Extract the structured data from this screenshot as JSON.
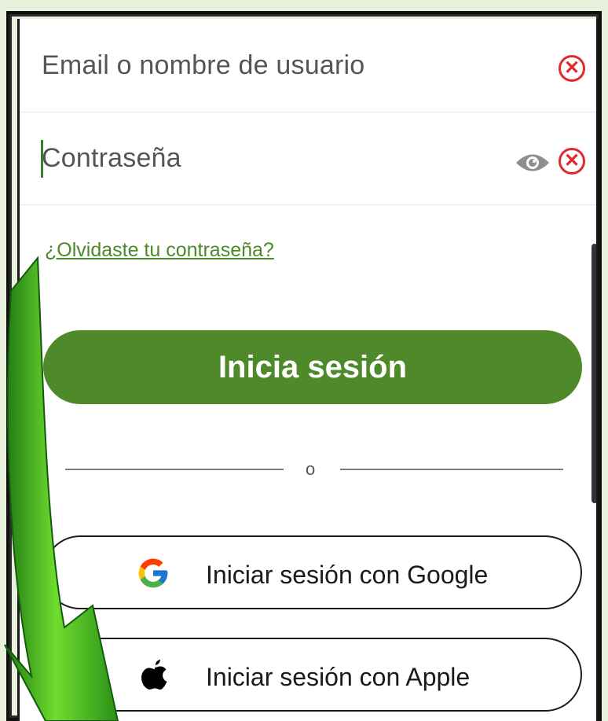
{
  "form": {
    "email_placeholder": "Email o nombre de usuario",
    "password_placeholder": "Contraseña",
    "forgot_link": "¿Olvidaste tu contraseña?",
    "login_button": "Inicia sesión",
    "divider_text": "o",
    "google_button": "Iniciar sesión con Google",
    "apple_button": "Iniciar sesión con Apple"
  },
  "icons": {
    "clear": "x-circle-icon",
    "visibility": "eye-icon",
    "google": "google-logo-icon",
    "apple": "apple-logo-icon",
    "annotation": "green-arrow"
  },
  "colors": {
    "accent": "#4f8a2a",
    "link": "#4a8a2b",
    "clear_icon": "#e0282e",
    "background": "#e9f1dc"
  }
}
